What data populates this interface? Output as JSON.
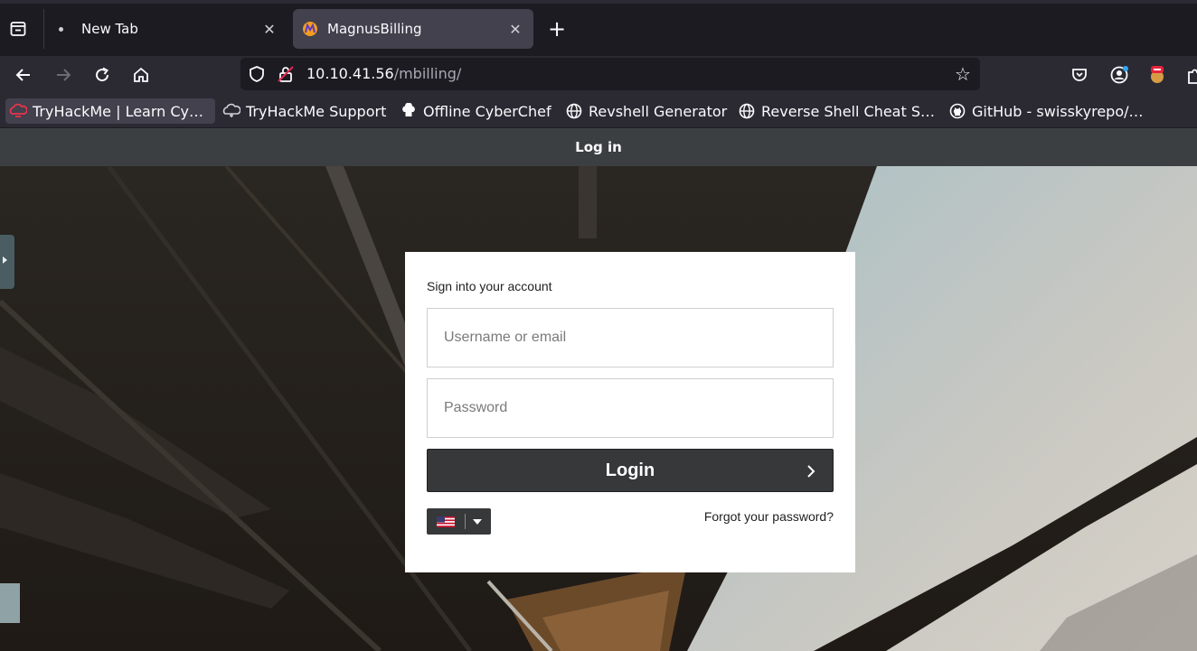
{
  "browser": {
    "tabs": [
      {
        "title": "New Tab",
        "active": false
      },
      {
        "title": "MagnusBilling",
        "active": true
      }
    ],
    "url": {
      "host": "10.10.41.56",
      "path": "/mbilling/"
    },
    "bookmarks": [
      {
        "label": "TryHackMe | Learn Cy…",
        "icon": "tryhackme-icon"
      },
      {
        "label": "TryHackMe Support",
        "icon": "cloud-icon"
      },
      {
        "label": "Offline CyberChef",
        "icon": "chef-hat-icon"
      },
      {
        "label": "Revshell Generator",
        "icon": "globe-icon"
      },
      {
        "label": "Reverse Shell Cheat S…",
        "icon": "globe-icon"
      },
      {
        "label": "GitHub - swisskyrepo/…",
        "icon": "github-icon"
      }
    ]
  },
  "page": {
    "header": "Log in",
    "card_title": "Sign into your account",
    "username_placeholder": "Username or email",
    "password_placeholder": "Password",
    "login_label": "Login",
    "forgot_label": "Forgot your password?",
    "language": "en-US flag"
  }
}
